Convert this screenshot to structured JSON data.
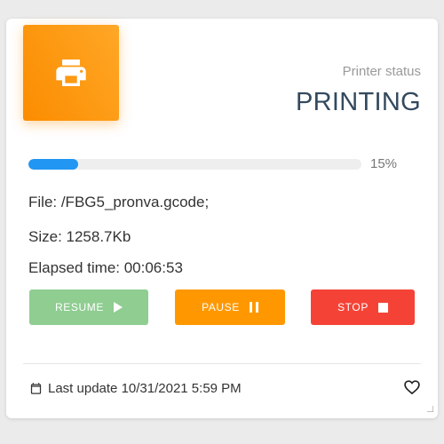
{
  "status": {
    "label": "Printer status",
    "value": "PRINTING"
  },
  "progress": {
    "percent": 15,
    "text": "15%"
  },
  "job": {
    "file": "File: /FBG5_pronva.gcode;",
    "size": "Size: 1258.7Kb",
    "elapsed": "Elapsed time: 00:06:53"
  },
  "buttons": {
    "resume": "RESUME",
    "pause": "PAUSE",
    "stop": "STOP"
  },
  "footer": {
    "last_update": "Last update 10/31/2021 5:59 PM"
  },
  "icons": {
    "header": "printer-icon",
    "resume": "play-icon",
    "pause": "pause-icon",
    "stop": "stop-icon",
    "footer": "calendar-icon",
    "favorite": "heart-icon"
  },
  "colors": {
    "accent": "#ff9800",
    "progress": "#2196f3",
    "resume": "#8fcd91",
    "pause": "#ff9800",
    "stop": "#f44336"
  }
}
